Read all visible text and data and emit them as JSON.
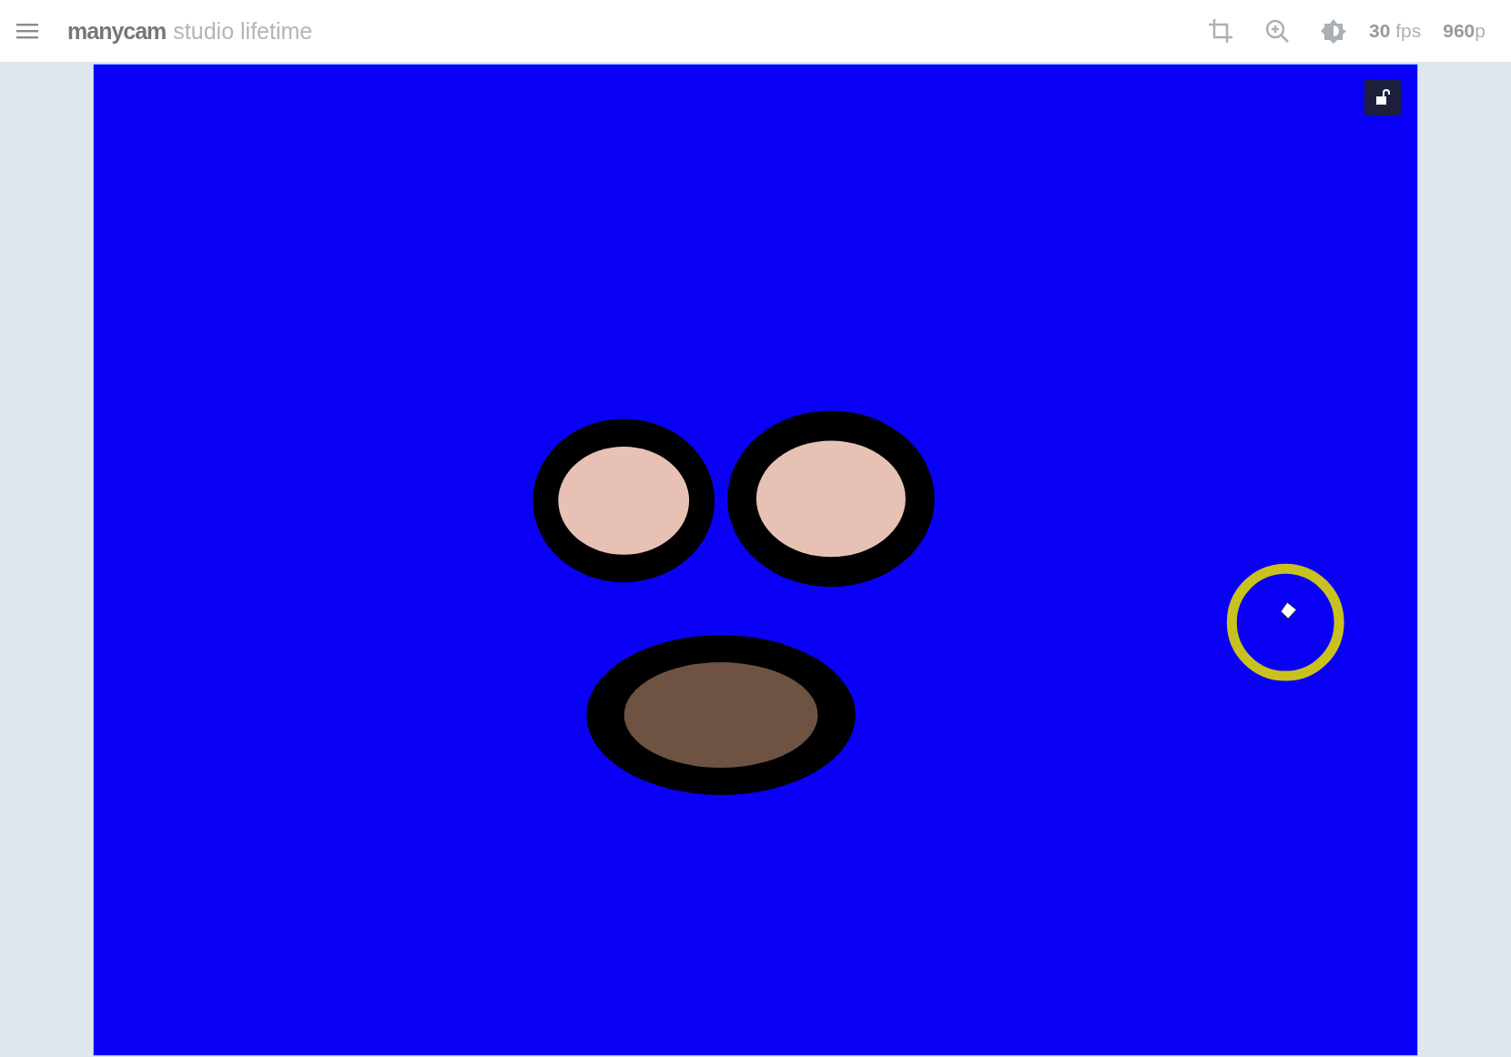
{
  "app_bar": {
    "brand": "manycam",
    "edition": "studio lifetime",
    "fps": "**30** fps",
    "resolution": "**960**p"
  },
  "canvas": {
    "layers": [
      {
        "kind": "eye"
      },
      {
        "kind": "eye"
      },
      {
        "kind": "mouth"
      }
    ]
  }
}
